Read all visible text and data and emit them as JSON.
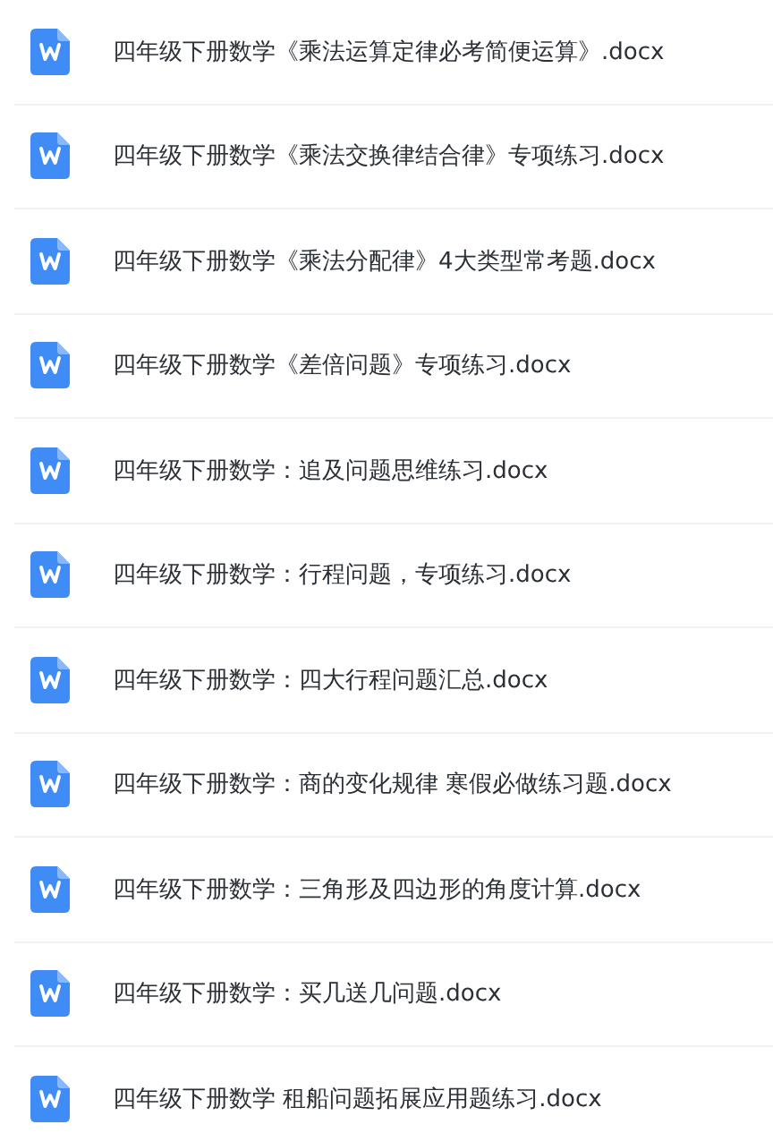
{
  "files": [
    {
      "name": "四年级下册数学《乘法运算定律必考简便运算》.docx"
    },
    {
      "name": "四年级下册数学《乘法交换律结合律》专项练习.docx"
    },
    {
      "name": "四年级下册数学《乘法分配律》4大类型常考题.docx"
    },
    {
      "name": "四年级下册数学《差倍问题》专项练习.docx"
    },
    {
      "name": "四年级下册数学：追及问题思维练习.docx"
    },
    {
      "name": "四年级下册数学：行程问题，专项练习.docx"
    },
    {
      "name": "四年级下册数学：四大行程问题汇总.docx"
    },
    {
      "name": "四年级下册数学：商的变化规律 寒假必做练习题.docx"
    },
    {
      "name": "四年级下册数学：三角形及四边形的角度计算.docx"
    },
    {
      "name": "四年级下册数学：买几送几问题.docx"
    },
    {
      "name": "四年级下册数学 租船问题拓展应用题练习.docx"
    }
  ]
}
